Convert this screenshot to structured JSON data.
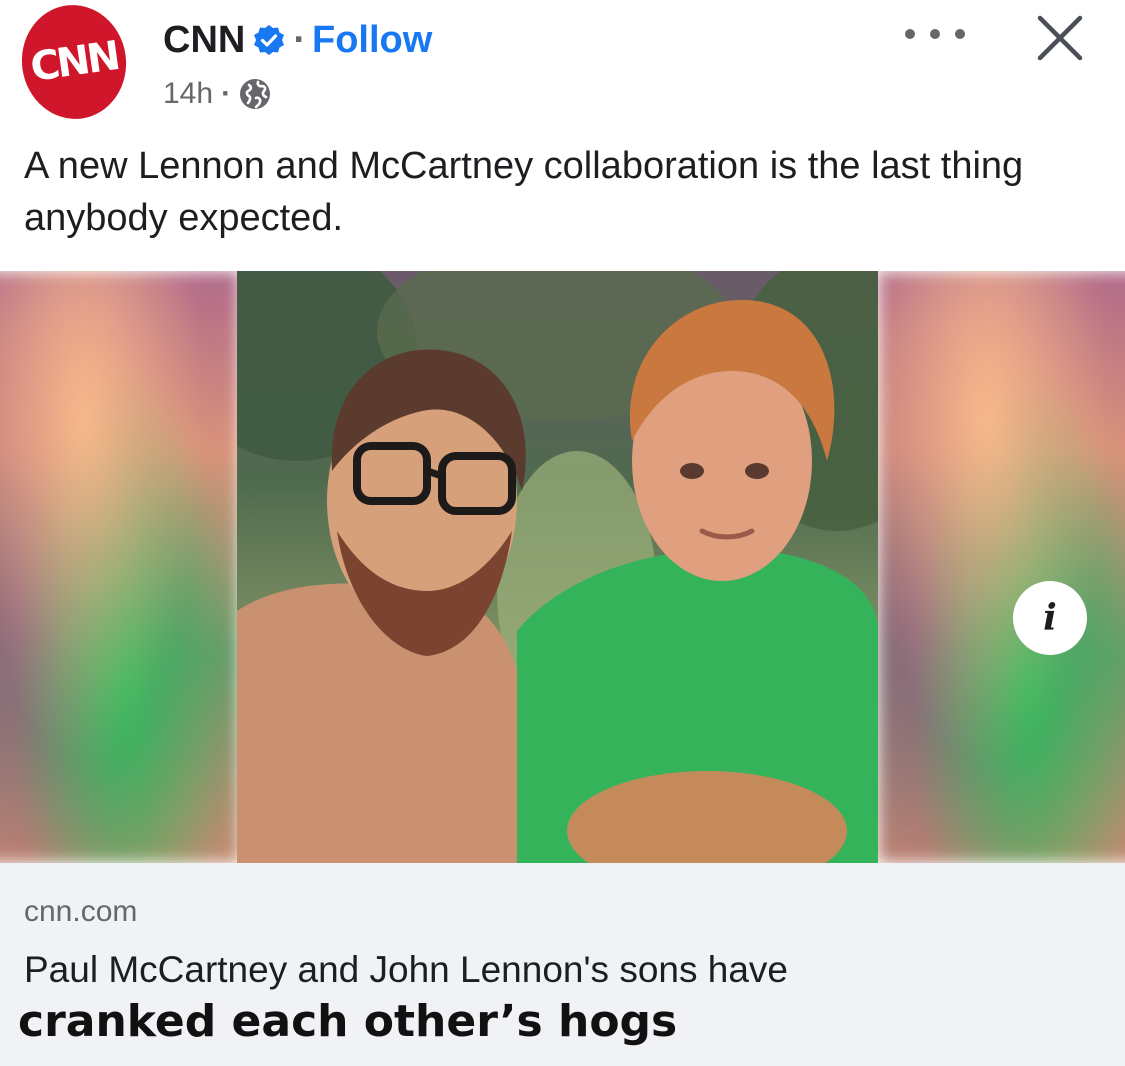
{
  "post": {
    "author_logo_text": "CNN",
    "author_name": "CNN",
    "separator": "·",
    "follow_label": "Follow",
    "timestamp": "14h",
    "meta_separator": "·",
    "privacy_icon": "globe-icon",
    "caption": "A new Lennon and McCartney collaboration is the last thing anybody expected."
  },
  "link_preview": {
    "domain": "cnn.com",
    "headline": "Paul McCartney and John Lennon's sons have"
  },
  "overlay_text": "cranked each other’s hogs",
  "image": {
    "info_label": "i"
  },
  "colors": {
    "brand_red": "#d0162b",
    "link_blue": "#1877f2",
    "verified_blue": "#1877f2",
    "muted_gray": "#65676b",
    "preview_bg": "#f0f2f5"
  }
}
